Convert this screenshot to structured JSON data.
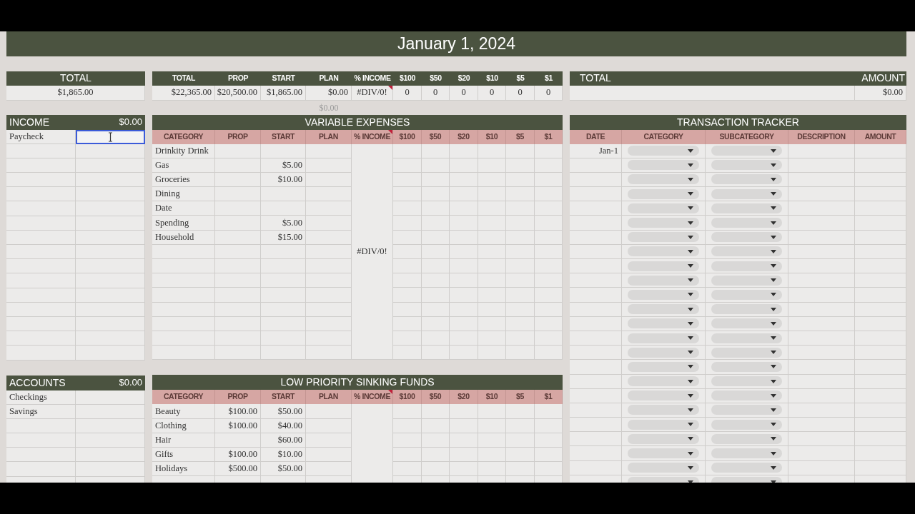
{
  "title": "January 1, 2024",
  "total_box": {
    "header": "TOTAL",
    "value": "$1,865.00"
  },
  "summary": {
    "columns": [
      {
        "label": "TOTAL",
        "note": false
      },
      {
        "label": "PROP",
        "note": false
      },
      {
        "label": "START",
        "note": false
      },
      {
        "label": "PLAN",
        "note": false
      },
      {
        "label": "% INCOME",
        "note": false
      },
      {
        "label": "$100",
        "note": false
      },
      {
        "label": "$50",
        "note": false
      },
      {
        "label": "$20",
        "note": false
      },
      {
        "label": "$10",
        "note": false
      },
      {
        "label": "$5",
        "note": false
      },
      {
        "label": "$1",
        "note": false
      }
    ],
    "values": [
      {
        "text": "$22,365.00",
        "note": false
      },
      {
        "text": "$20,500.00",
        "note": false
      },
      {
        "text": "$1,865.00",
        "note": false
      },
      {
        "text": "$0.00",
        "note": false
      },
      {
        "text": "#DIV/0!",
        "note": true
      },
      {
        "text": "0",
        "note": false
      },
      {
        "text": "0",
        "note": false
      },
      {
        "text": "0",
        "note": false
      },
      {
        "text": "0",
        "note": false
      },
      {
        "text": "0",
        "note": false
      },
      {
        "text": "0",
        "note": false
      }
    ],
    "plan_subtotal": "$0.00"
  },
  "income": {
    "title": "INCOME",
    "total": "$0.00",
    "rows": [
      {
        "name": "Paycheck",
        "selected": true
      }
    ]
  },
  "accounts": {
    "title": "ACCOUNTS",
    "total": "$0.00",
    "rows": [
      {
        "name": "Checkings",
        "selected": false
      },
      {
        "name": "Savings",
        "selected": false
      }
    ]
  },
  "variable_expenses": {
    "title": "VARIABLE EXPENSES",
    "percent_income": "#DIV/0!",
    "columns": [
      {
        "label": "CATEGORY",
        "note": false
      },
      {
        "label": "PROP",
        "note": false
      },
      {
        "label": "START",
        "note": false
      },
      {
        "label": "PLAN",
        "note": false
      },
      {
        "label": "% INCOME",
        "note": true
      },
      {
        "label": "$100",
        "note": false
      },
      {
        "label": "$50",
        "note": false
      },
      {
        "label": "$20",
        "note": false
      },
      {
        "label": "$10",
        "note": false
      },
      {
        "label": "$5",
        "note": false
      },
      {
        "label": "$1",
        "note": false
      }
    ],
    "rows": [
      {
        "category": "Drinkity Drink"
      },
      {
        "category": "Gas",
        "start": "$5.00"
      },
      {
        "category": "Groceries",
        "start": "$10.00"
      },
      {
        "category": "Dining"
      },
      {
        "category": "Date"
      },
      {
        "category": "Spending",
        "start": "$5.00"
      },
      {
        "category": "Household",
        "start": "$15.00"
      }
    ]
  },
  "low_priority_sinking_funds": {
    "title": "LOW PRIORITY SINKING FUNDS",
    "columns": [
      {
        "label": "CATEGORY",
        "note": false
      },
      {
        "label": "PROP",
        "note": false
      },
      {
        "label": "START",
        "note": false
      },
      {
        "label": "PLAN",
        "note": false
      },
      {
        "label": "% INCOME",
        "note": true
      },
      {
        "label": "$100",
        "note": false
      },
      {
        "label": "$50",
        "note": false
      },
      {
        "label": "$20",
        "note": false
      },
      {
        "label": "$10",
        "note": false
      },
      {
        "label": "$5",
        "note": false
      },
      {
        "label": "$1",
        "note": false
      }
    ],
    "rows": [
      {
        "category": "Beauty",
        "prop": "$100.00",
        "start": "$50.00"
      },
      {
        "category": "Clothing",
        "prop": "$100.00",
        "start": "$40.00"
      },
      {
        "category": "Hair",
        "start": "$60.00"
      },
      {
        "category": "Gifts",
        "prop": "$100.00",
        "start": "$10.00"
      },
      {
        "category": "Holidays",
        "prop": "$500.00",
        "start": "$50.00"
      }
    ]
  },
  "amount_box": {
    "label": "TOTAL",
    "header": "AMOUNT",
    "value": "$0.00"
  },
  "transaction_tracker": {
    "title": "TRANSACTION TRACKER",
    "columns": [
      "DATE",
      "CATEGORY",
      "SUBCATEGORY",
      "DESCRIPTION",
      "AMOUNT"
    ],
    "rows": [
      {
        "date": "Jan-1"
      }
    ]
  }
}
